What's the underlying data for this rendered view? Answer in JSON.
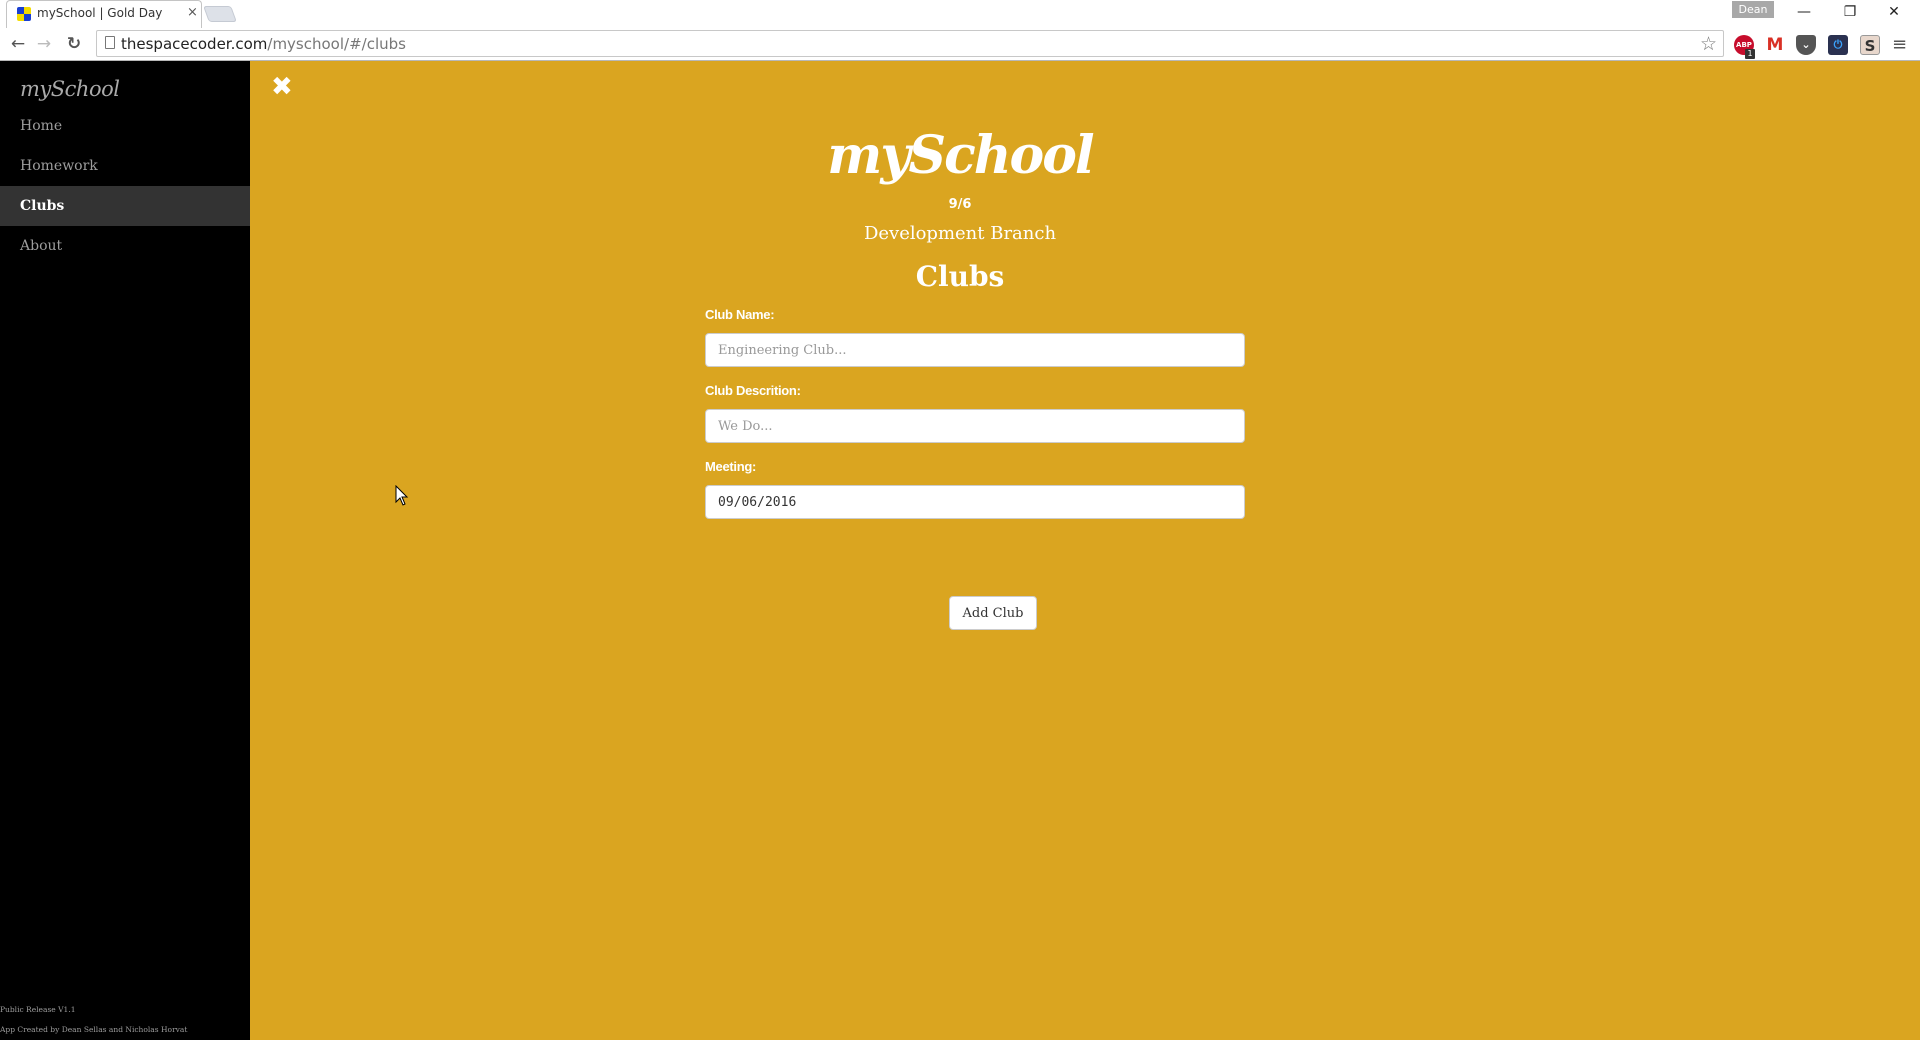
{
  "browser": {
    "tab_title": "mySchool | Gold Day",
    "tab_close": "×",
    "profile_name": "Dean",
    "window_controls": {
      "minimize": "—",
      "maximize": "❐",
      "close": "✕"
    },
    "nav": {
      "back": "←",
      "forward": "→",
      "reload": "↻"
    },
    "url_host": "thespacecoder.com",
    "url_path": "/myschool/#/clubs",
    "bookmark_star": "☆",
    "extensions": [
      {
        "name": "adblock-plus",
        "label": "ABP",
        "badge": "1"
      },
      {
        "name": "gmail",
        "label": "M"
      },
      {
        "name": "pocket",
        "label": "⌄"
      },
      {
        "name": "power",
        "label": "⏻"
      },
      {
        "name": "s-extension",
        "label": "S"
      }
    ],
    "menu": "≡"
  },
  "sidebar": {
    "logo": "mySchool",
    "items": [
      {
        "label": "Home",
        "active": false
      },
      {
        "label": "Homework",
        "active": false
      },
      {
        "label": "Clubs",
        "active": true
      },
      {
        "label": "About",
        "active": false
      }
    ],
    "footer": {
      "release": "Public Release V1.1",
      "credits": "App Created by Dean Sellas and Nicholas Horvat"
    }
  },
  "main": {
    "close_icon": "✖",
    "brand": "mySchool",
    "version": "9/6",
    "branch": "Development Branch",
    "page_title": "Clubs",
    "form": {
      "club_name": {
        "label": "Club Name:",
        "value": "",
        "placeholder": "Engineering Club..."
      },
      "club_description": {
        "label": "Club Descrition:",
        "value": "",
        "placeholder": "We Do..."
      },
      "meeting": {
        "label": "Meeting:",
        "value": "09/06/2016"
      },
      "submit_label": "Add Club"
    }
  },
  "colors": {
    "accent_gold": "#DAA520",
    "sidebar_bg": "#000000",
    "sidebar_active": "#333333"
  }
}
